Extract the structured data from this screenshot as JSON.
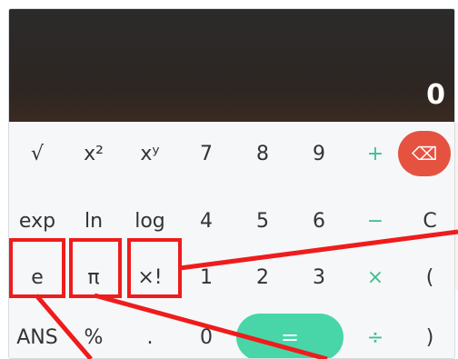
{
  "display": {
    "value": "0"
  },
  "keys": {
    "row1": [
      "√",
      "x²",
      "xʸ",
      "7",
      "8",
      "9",
      "+",
      "⌫"
    ],
    "row2": [
      "exp",
      "ln",
      "log",
      "4",
      "5",
      "6",
      "−",
      "C"
    ],
    "row3": [
      "e",
      "π",
      "×!",
      "1",
      "2",
      "3",
      "×",
      "("
    ],
    "row4": [
      "ANS",
      "%",
      ".",
      "0",
      "=",
      "÷",
      ")"
    ]
  },
  "colors": {
    "display_bg": "#2b2b2b",
    "operator": "#3fbf8e",
    "delete_bg": "#e55340",
    "equals_bg": "#48d6a9",
    "annotation": "#ee1c1c"
  },
  "icons": {
    "delete": "backspace-icon"
  }
}
